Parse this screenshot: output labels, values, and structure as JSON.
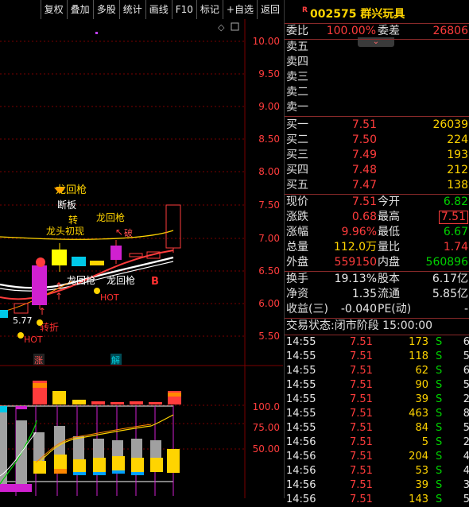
{
  "toolbar": [
    "复权",
    "叠加",
    "多股",
    "统计",
    "画线",
    "F10",
    "标记",
    "+自选",
    "返回"
  ],
  "chart": {
    "price_ticks": [
      "10.00",
      "9.50",
      "9.00",
      "8.50",
      "8.00",
      "7.50",
      "7.00",
      "6.50",
      "6.00",
      "5.50"
    ],
    "volume_ticks": [
      "100.0",
      "75.00",
      "50.00"
    ],
    "low_label": "5.77",
    "annotations": [
      "龙回枪",
      "断板",
      "转",
      "龙头初现",
      "龙回枪",
      "破",
      "龙回枪",
      "龙回枪",
      "B",
      "HOT",
      "HOT",
      "转折",
      "涨",
      "解",
      "战"
    ],
    "colors": {
      "up": "#ff3c3c",
      "down": "#00c0e0",
      "yellow": "#ffd400",
      "grid": "#7a0000"
    }
  },
  "stock": {
    "r_badge": "R",
    "code_name": "002575 群兴玩具"
  },
  "header": {
    "ratio_label": "委比",
    "ratio_value": "100.00%",
    "diff_label": "委差",
    "diff_value": "26806"
  },
  "sells": [
    "卖五",
    "卖四",
    "卖三",
    "卖二",
    "卖一"
  ],
  "buys": [
    {
      "label": "买一",
      "price": "7.51",
      "vol": "26039"
    },
    {
      "label": "买二",
      "price": "7.50",
      "vol": "224"
    },
    {
      "label": "买三",
      "price": "7.49",
      "vol": "193"
    },
    {
      "label": "买四",
      "price": "7.48",
      "vol": "212"
    },
    {
      "label": "买五",
      "price": "7.47",
      "vol": "138"
    }
  ],
  "quote": [
    {
      "l1": "现价",
      "v1": "7.51",
      "c1": "red",
      "l2": "今开",
      "v2": "6.82",
      "c2": "green",
      "box": true
    },
    {
      "l1": "涨跌",
      "v1": "0.68",
      "c1": "red",
      "l2": "最高",
      "v2": "7.51",
      "c2": "red",
      "box": true
    },
    {
      "l1": "涨幅",
      "v1": "9.96%",
      "c1": "red",
      "l2": "最低",
      "v2": "6.67",
      "c2": "green"
    },
    {
      "l1": "总量",
      "v1": "112.0万",
      "c1": "yellow",
      "l2": "量比",
      "v2": "1.74",
      "c2": "red"
    },
    {
      "l1": "外盘",
      "v1": "559150",
      "c1": "red",
      "l2": "内盘",
      "v2": "560896",
      "c2": "green"
    }
  ],
  "fund": [
    {
      "l1": "换手",
      "v1": "19.13%",
      "l2": "股本",
      "v2": "6.17亿"
    },
    {
      "l1": "净资",
      "v1": "1.35",
      "l2": "流通",
      "v2": "5.85亿"
    },
    {
      "l1": "收益(三)",
      "v1": "-0.040",
      "l2": "PE(动)",
      "v2": "-"
    }
  ],
  "status": "交易状态:闭市阶段 15:00:00",
  "ticks": [
    {
      "t": "14:55",
      "p": "7.51",
      "v": "173",
      "s": "S",
      "n": "6"
    },
    {
      "t": "14:55",
      "p": "7.51",
      "v": "118",
      "s": "S",
      "n": "5"
    },
    {
      "t": "14:55",
      "p": "7.51",
      "v": "62",
      "s": "S",
      "n": "6"
    },
    {
      "t": "14:55",
      "p": "7.51",
      "v": "90",
      "s": "S",
      "n": "5"
    },
    {
      "t": "14:55",
      "p": "7.51",
      "v": "39",
      "s": "S",
      "n": "2"
    },
    {
      "t": "14:55",
      "p": "7.51",
      "v": "463",
      "s": "S",
      "n": "8"
    },
    {
      "t": "14:55",
      "p": "7.51",
      "v": "84",
      "s": "S",
      "n": "5"
    },
    {
      "t": "14:56",
      "p": "7.51",
      "v": "5",
      "s": "S",
      "n": "2"
    },
    {
      "t": "14:56",
      "p": "7.51",
      "v": "204",
      "s": "S",
      "n": "4"
    },
    {
      "t": "14:56",
      "p": "7.51",
      "v": "53",
      "s": "S",
      "n": "4"
    },
    {
      "t": "14:56",
      "p": "7.51",
      "v": "39",
      "s": "S",
      "n": "3"
    },
    {
      "t": "14:56",
      "p": "7.51",
      "v": "143",
      "s": "S",
      "n": "5"
    }
  ]
}
